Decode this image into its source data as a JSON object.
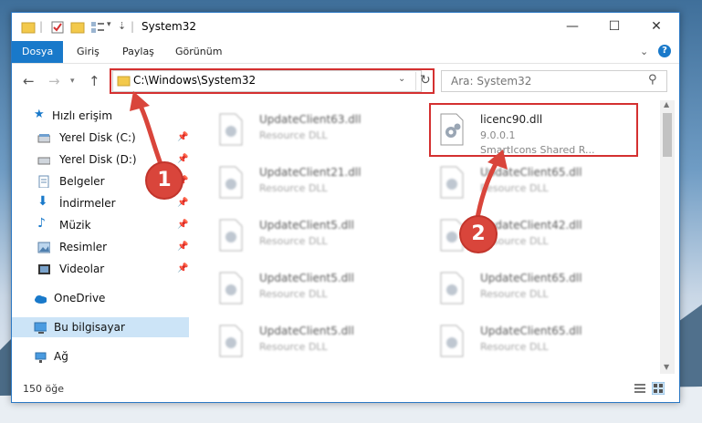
{
  "window": {
    "title": "System32",
    "controls": {
      "minimize": "—",
      "maximize": "☐",
      "close": "✕"
    }
  },
  "ribbon": {
    "tabs": [
      {
        "label": "Dosya",
        "active": true
      },
      {
        "label": "Giriş"
      },
      {
        "label": "Paylaş"
      },
      {
        "label": "Görünüm"
      }
    ]
  },
  "navigation": {
    "address": "C:\\Windows\\System32",
    "search_placeholder": "Ara: System32"
  },
  "sidebar": {
    "items": [
      {
        "label": "Hızlı erişim",
        "icon": "star-icon",
        "pinned": false
      },
      {
        "label": "Yerel Disk (C:)",
        "icon": "drive-icon",
        "pinned": true
      },
      {
        "label": "Yerel Disk (D:)",
        "icon": "drive-icon",
        "pinned": true
      },
      {
        "label": "Belgeler",
        "icon": "documents-icon",
        "pinned": true
      },
      {
        "label": "İndirmeler",
        "icon": "download-icon",
        "pinned": true
      },
      {
        "label": "Müzik",
        "icon": "music-icon",
        "pinned": true
      },
      {
        "label": "Resimler",
        "icon": "pictures-icon",
        "pinned": true
      },
      {
        "label": "Videolar",
        "icon": "videos-icon",
        "pinned": true
      },
      {
        "label": "OneDrive",
        "icon": "cloud-icon",
        "pinned": false
      },
      {
        "label": "Bu bilgisayar",
        "icon": "computer-icon",
        "pinned": false,
        "selected": true
      },
      {
        "label": "Ağ",
        "icon": "network-icon",
        "pinned": false
      }
    ]
  },
  "files": [
    {
      "name": "UpdateClient63.dll",
      "sub": "Resource DLL"
    },
    {
      "name": "licenc90.dll",
      "sub": "9.0.0.1",
      "sub2": "SmartIcons Shared R..."
    },
    {
      "name": "UpdateClient21.dll",
      "sub": "Resource DLL"
    },
    {
      "name": "UpdateClient65.dll",
      "sub": "Resource DLL"
    },
    {
      "name": "UpdateClient5.dll",
      "sub": "Resource DLL"
    },
    {
      "name": "UpdateClient42.dll",
      "sub": "Resource DLL"
    },
    {
      "name": "UpdateClient5.dll",
      "sub": "Resource DLL"
    },
    {
      "name": "UpdateClient65.dll",
      "sub": "Resource DLL"
    },
    {
      "name": "UpdateClient5.dll",
      "sub": "Resource DLL"
    },
    {
      "name": "UpdateClient65.dll",
      "sub": "Resource DLL"
    }
  ],
  "status": {
    "item_count": "150 öğe"
  },
  "annotations": {
    "badge1": "1",
    "badge2": "2",
    "accent": "#d43030"
  }
}
